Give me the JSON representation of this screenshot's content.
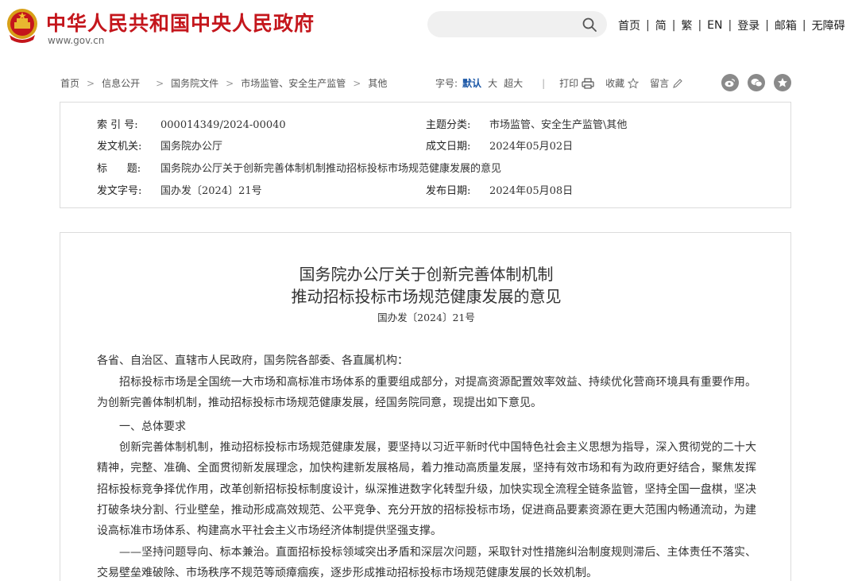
{
  "header": {
    "site_name": "中华人民共和国中央人民政府",
    "site_url": "www.gov.cn",
    "search_placeholder": "",
    "nav": [
      "首页",
      "简",
      "繁",
      "EN",
      "登录",
      "邮箱",
      "无障碍"
    ],
    "brand_color": "#c4161c"
  },
  "breadcrumb": [
    "首页",
    "信息公开",
    "国务院文件",
    "市场监管、安全生产监管",
    "其他"
  ],
  "tools": {
    "font_label": "字号:",
    "font_sizes": [
      "默认",
      "大",
      "超大"
    ],
    "active_size": "默认",
    "print": "打印",
    "favorite": "收藏",
    "comment": "留言",
    "social_icons": [
      "weibo-icon",
      "wechat-icon",
      "qzone-icon"
    ]
  },
  "info": {
    "index_label": "索 引 号:",
    "index_value": "000014349/2024-00040",
    "topic_label": "主题分类:",
    "topic_value": "市场监管、安全生产监管\\其他",
    "issuer_label": "发文机关:",
    "issuer_value": "国务院办公厅",
    "created_label": "成文日期:",
    "created_value": "2024年05月02日",
    "title_label": "标      题:",
    "title_value": "国务院办公厅关于创新完善体制机制推动招标投标市场规范健康发展的意见",
    "docno_label": "发文字号:",
    "docno_value": "国办发〔2024〕21号",
    "published_label": "发布日期:",
    "published_value": "2024年05月08日"
  },
  "article": {
    "title_line1": "国务院办公厅关于创新完善体制机制",
    "title_line2": "推动招标投标市场规范健康发展的意见",
    "doc_no": "国办发〔2024〕21号",
    "salutation": "各省、自治区、直辖市人民政府，国务院各部委、各直属机构：",
    "intro": "招标投标市场是全国统一大市场和高标准市场体系的重要组成部分，对提高资源配置效率效益、持续优化营商环境具有重要作用。为创新完善体制机制，推动招标投标市场规范健康发展，经国务院同意，现提出如下意见。",
    "section1_heading": "一、总体要求",
    "section1_body": "创新完善体制机制，推动招标投标市场规范健康发展，要坚持以习近平新时代中国特色社会主义思想为指导，深入贯彻党的二十大精神，完整、准确、全面贯彻新发展理念，加快构建新发展格局，着力推动高质量发展，坚持有效市场和有为政府更好结合，聚焦发挥招标投标竞争择优作用，改革创新招标投标制度设计，纵深推进数字化转型升级，加快实现全流程全链条监管，坚持全国一盘棋，坚决打破条块分割、行业壁垒，推动形成高效规范、公平竞争、充分开放的招标投标市场，促进商品要素资源在更大范围内畅通流动，为建设高标准市场体系、构建高水平社会主义市场经济体制提供坚强支撑。",
    "principle1": "——坚持问题导向、标本兼治。直面招标投标领域突出矛盾和深层次问题，采取针对性措施纠治制度规则滞后、主体责任不落实、交易壁垒难破除、市场秩序不规范等顽瘴痼疾，逐步形成推动招标投标市场规范健康发展的长效机制。"
  }
}
